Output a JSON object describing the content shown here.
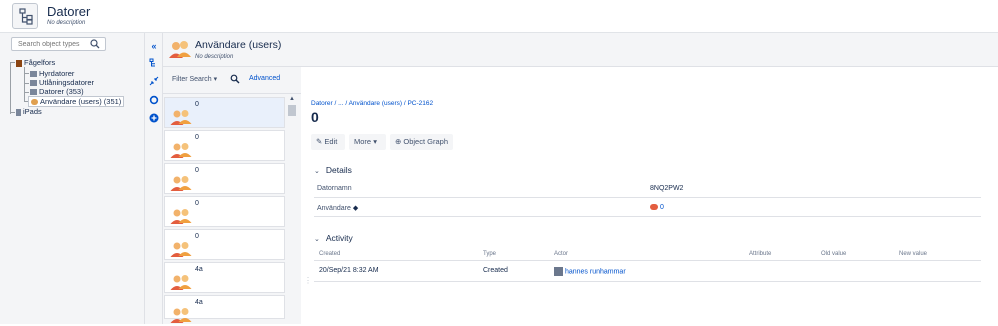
{
  "header": {
    "title": "Datorer",
    "description": "No description"
  },
  "tree": {
    "search_placeholder": "Search object types",
    "root": "Fågelfors",
    "items": [
      {
        "label": "Hyrdatorer"
      },
      {
        "label": "Utlåningsdatorer"
      },
      {
        "label": "Datorer (353)"
      },
      {
        "label": "Användare (users) (351)",
        "selected": true
      }
    ],
    "second_root": "iPads"
  },
  "object_type": {
    "title": "Användare (users)",
    "description": "No description"
  },
  "filter": {
    "search_label": "Filter Search",
    "advanced_label": "Advanced"
  },
  "list": {
    "items": [
      {
        "label": "0",
        "selected": true
      },
      {
        "label": "0"
      },
      {
        "label": "0"
      },
      {
        "label": "0"
      },
      {
        "label": "0"
      },
      {
        "label": "4a"
      },
      {
        "label": "4a"
      }
    ]
  },
  "detail": {
    "breadcrumb": "Datorer / ... / Användare (users) / PC-2162",
    "object_name": "0",
    "buttons": {
      "edit": "Edit",
      "more": "More",
      "graph": "Object Graph"
    },
    "details": {
      "title": "Details",
      "rows": [
        {
          "name": "Datornamn",
          "value": "8NQ2PW2"
        },
        {
          "name": "Användare",
          "value": "0"
        }
      ]
    },
    "activity": {
      "title": "Activity",
      "headers": {
        "created": "Created",
        "type": "Type",
        "actor": "Actor",
        "attribute": "Attribute",
        "old": "Old value",
        "new": "New value"
      },
      "rows": [
        {
          "created": "20/Sep/21 8:32 AM",
          "type": "Created",
          "actor": "hannes runhammar",
          "attribute": "",
          "old": "",
          "new": ""
        }
      ]
    }
  },
  "colors": {
    "link": "#0052cc",
    "panel": "#f4f5f7",
    "selected": "#e9f0fb"
  }
}
